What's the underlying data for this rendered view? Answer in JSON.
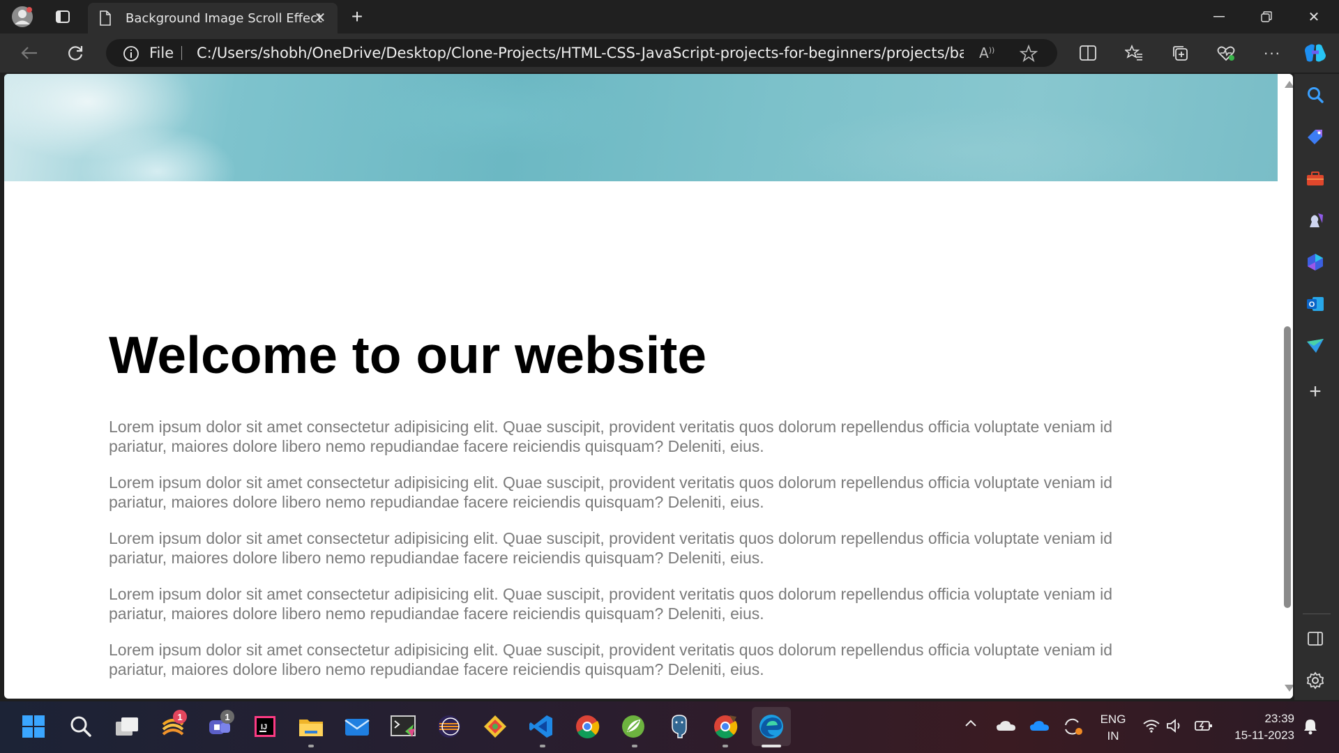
{
  "browser": {
    "tab_title": "Background Image Scroll Effect",
    "address_scheme_label": "File",
    "address_url": "C:/Users/shobh/OneDrive/Desktop/Clone-Projects/HTML-CSS-JavaScript-projects-for-beginners/projects/background..."
  },
  "page": {
    "heading": "Welcome to our website",
    "paragraphs": [
      "Lorem ipsum dolor sit amet consectetur adipisicing elit. Quae suscipit, provident veritatis quos dolorum repellendus officia voluptate veniam id pariatur, maiores dolore libero nemo repudiandae facere reiciendis quisquam? Deleniti, eius.",
      "Lorem ipsum dolor sit amet consectetur adipisicing elit. Quae suscipit, provident veritatis quos dolorum repellendus officia voluptate veniam id pariatur, maiores dolore libero nemo repudiandae facere reiciendis quisquam? Deleniti, eius.",
      "Lorem ipsum dolor sit amet consectetur adipisicing elit. Quae suscipit, provident veritatis quos dolorum repellendus officia voluptate veniam id pariatur, maiores dolore libero nemo repudiandae facere reiciendis quisquam? Deleniti, eius.",
      "Lorem ipsum dolor sit amet consectetur adipisicing elit. Quae suscipit, provident veritatis quos dolorum repellendus officia voluptate veniam id pariatur, maiores dolore libero nemo repudiandae facere reiciendis quisquam? Deleniti, eius.",
      "Lorem ipsum dolor sit amet consectetur adipisicing elit. Quae suscipit, provident veritatis quos dolorum repellendus officia voluptate veniam id pariatur, maiores dolore libero nemo repudiandae facere reiciendis quisquam? Deleniti, eius."
    ],
    "hero_image": "ocean-water-texture"
  },
  "sidebar_icons": [
    "search-icon",
    "tag-icon",
    "toolbox-icon",
    "games-icon",
    "copilot-icon",
    "outlook-icon",
    "send-icon",
    "add-icon",
    "panel-icon",
    "settings-icon"
  ],
  "taskbar": {
    "apps": [
      "windows-start",
      "search",
      "task-view",
      "wamp",
      "teams",
      "intellij",
      "file-explorer",
      "mail",
      "terminal",
      "eclipse",
      "git",
      "vscode",
      "chrome",
      "spring-tools",
      "postgresql",
      "chrome-canary",
      "edge"
    ],
    "badges": {
      "wamp": "1",
      "teams": "1"
    },
    "language_line1": "ENG",
    "language_line2": "IN",
    "time": "23:39",
    "date": "15-11-2023"
  },
  "colors": {
    "chrome_dark": "#202020",
    "toolbar": "#2e2e2e",
    "heading": "#000000",
    "paragraph": "#7a7a7a",
    "hero_teal": "#6cb8c3"
  }
}
